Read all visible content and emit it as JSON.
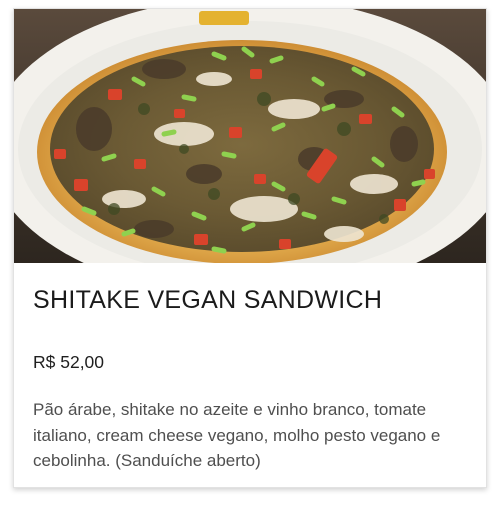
{
  "product": {
    "image_alt": "Shitake vegan sandwich photo",
    "title": "SHITAKE VEGAN SANDWICH",
    "price": "R$ 52,00",
    "description": "Pão árabe, shitake no azeite e vinho branco, tomate italiano, cream cheese vegano, molho pesto vegano e cebolinha. (Sanduíche aberto)"
  },
  "colors": {
    "title": "#1b1b1b",
    "price": "#1f1f1f",
    "description": "#4f4f4f",
    "card_border": "#e2e2e2"
  }
}
